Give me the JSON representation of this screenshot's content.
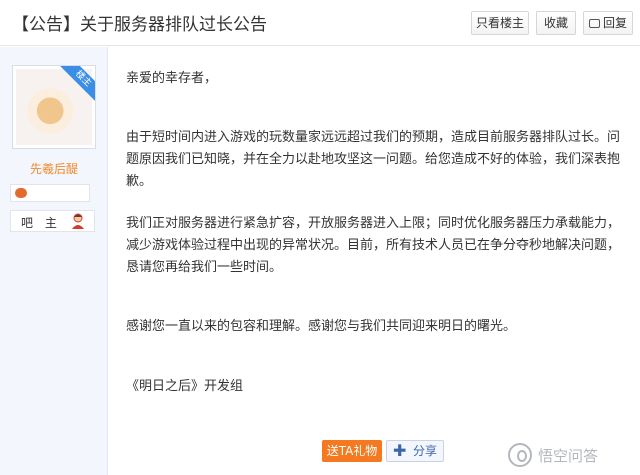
{
  "header": {
    "title": "【公告】关于服务器排队过长公告",
    "only_owner": "只看楼主",
    "favorite": "收藏",
    "reply": "回复"
  },
  "author": {
    "avatar_badge": "楼主",
    "username": "先羲后醍",
    "role": "吧 主",
    "accent": "#f08c2d"
  },
  "post": {
    "greeting": "亲爱的幸存者，",
    "paragraph1": "由于短时间内进入游戏的玩数量家远远超过我们的预期，造成目前服务器排队过长。问题原因我们已知晓，并在全力以赴地攻坚这一问题。给您造成不好的体验，我们深表抱歉。",
    "paragraph2": "我们正对服务器进行紧急扩容，开放服务器进入上限；同时优化服务器压力承载能力，减少游戏体验过程中出现的异常状况。目前，所有技术人员已在争分夺秒地解决问题，恳请您再给我们一些时间。",
    "paragraph3": "感谢您一直以来的包容和理解。感谢您与我们共同迎来明日的曙光。",
    "signature": "《明日之后》开发组"
  },
  "actions": {
    "gift": "送TA礼物",
    "share": "分享",
    "gift_color": "#f47920"
  },
  "watermark": {
    "text": "悟空问答"
  }
}
